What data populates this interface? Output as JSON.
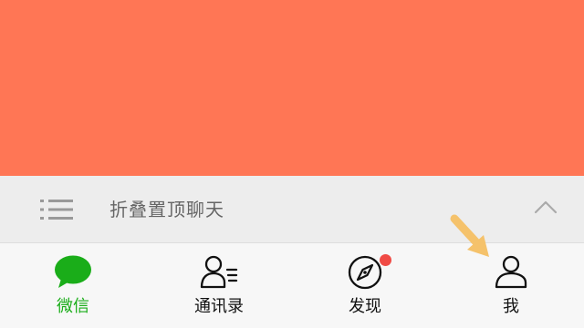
{
  "collapse_bar": {
    "label": "折叠置顶聊天"
  },
  "tabs": [
    {
      "label": "微信",
      "icon": "chat-bubble-icon",
      "active": true
    },
    {
      "label": "通讯录",
      "icon": "contacts-icon",
      "active": false
    },
    {
      "label": "发现",
      "icon": "compass-icon",
      "active": false,
      "badge": true
    },
    {
      "label": "我",
      "icon": "person-icon",
      "active": false
    }
  ],
  "colors": {
    "banner": "#ff7655",
    "active_tab": "#1aad19",
    "badge": "#f04b45",
    "arrow": "#f5c26b"
  }
}
